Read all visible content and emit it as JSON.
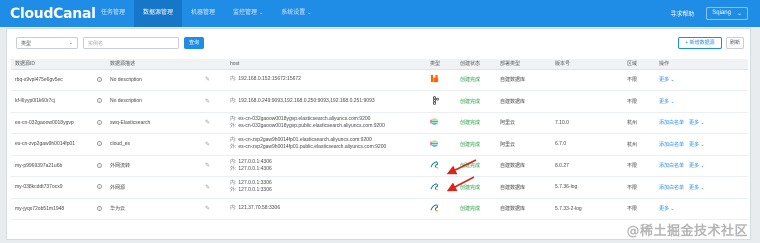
{
  "app": {
    "logo": "CloudCanal",
    "nav": [
      {
        "label": "任务管理",
        "active": false
      },
      {
        "label": "数据源管理",
        "active": true
      },
      {
        "label": "机器管理",
        "active": false
      },
      {
        "label": "监控管理",
        "active": false,
        "dropdown": true
      },
      {
        "label": "系统设置",
        "active": false,
        "dropdown": true
      }
    ],
    "help": "寻求帮助",
    "user": "Sqiang",
    "nav_arrow": "⌄"
  },
  "filters": {
    "type_placeholder": "类型",
    "search_placeholder": "实例名",
    "search_button": "查询",
    "add_button": "+ 新增数据源",
    "refresh_button": "刷新",
    "select_arrow": "⌄"
  },
  "table": {
    "headers": [
      "数据源ID",
      "数据源描述",
      "",
      "host",
      "类型",
      "创建状态",
      "部署类型",
      "版本号",
      "区域",
      "操作"
    ],
    "rows": [
      {
        "id": "rbq-s9vpl475e6gv5ec",
        "desc": "No description",
        "hosts": [
          {
            "p": "内:",
            "v": "192.168.0.152:15672:15672"
          }
        ],
        "type_icon": "rabbitmq",
        "status": "创建完成",
        "deploy": "自建数据库",
        "version": "",
        "region": "不限",
        "actions": [
          "更多 ⌄"
        ]
      },
      {
        "id": "kf-l6yyp0l1k60r7cj",
        "desc": "No description",
        "hosts": [
          {
            "p": "内:",
            "v": "192.168.0.249:9093,192.168.0.250:9093,192.168.0.251:9093"
          }
        ],
        "type_icon": "kafka",
        "status": "创建完成",
        "deploy": "自建数据库",
        "version": "",
        "region": "不限",
        "actions": [
          "更多 ⌄"
        ]
      },
      {
        "id": "es-cn-032gaoow0018ygvp",
        "desc": "swq-Elasticsearch",
        "hosts": [
          {
            "p": "内:",
            "v": "es-cn-032gaoow0018ygvp.elasticsearch.aliyuncs.com:9200"
          },
          {
            "p": "外:",
            "v": "es-cn-032gaoow0018ygvp.public.elasticsearch.aliyuncs.com:9200"
          }
        ],
        "type_icon": "elasticsearch",
        "status": "创建完成",
        "deploy": "阿里云",
        "version": "7.10.0",
        "region": "杭州",
        "actions": [
          "添加白名单",
          "更多 ⌄"
        ]
      },
      {
        "id": "es-cn-zvp2gaw9h0014fp01",
        "desc": "cloud_es",
        "hosts": [
          {
            "p": "内:",
            "v": "es-cn-zvp2gaw9h0014fp01.elasticsearch.aliyuncs.com:9200"
          },
          {
            "p": "外:",
            "v": "es-cn-zvp2gaw9h0014fp01.public.elasticsearch.aliyuncs.com:9200"
          }
        ],
        "type_icon": "elasticsearch",
        "status": "创建完成",
        "deploy": "阿里云",
        "version": "6.7.0",
        "region": "杭州",
        "actions": [
          "添加白名单",
          "更多 ⌄"
        ]
      },
      {
        "id": "my-p9969397a21u6b",
        "desc": "外网流转",
        "hosts": [
          {
            "p": "内:",
            "v": "127.0.0.1:4306"
          },
          {
            "p": "外:",
            "v": "127.0.0.1:4306"
          }
        ],
        "type_icon": "mysql",
        "status": "创建完成",
        "deploy": "自建数据库",
        "version": "8.0.27",
        "region": "不限",
        "actions": [
          "添加白名单",
          "更多 ⌄"
        ]
      },
      {
        "id": "my-038kcddt737ocx9",
        "desc": "外网源",
        "hosts": [
          {
            "p": "内:",
            "v": "127.0.0.1:3306"
          },
          {
            "p": "外:",
            "v": "127.0.0.1:3306"
          }
        ],
        "type_icon": "mysql",
        "status": "创建完成",
        "deploy": "自建数据库",
        "version": "5.7.36-log",
        "region": "不限",
        "actions": [
          "添加白名单",
          "更多 ⌄"
        ]
      },
      {
        "id": "my-jyqx72ob51m1948",
        "desc": "华为云",
        "hosts": [
          {
            "p": "内:",
            "v": "121.37.70.58:3306"
          }
        ],
        "type_icon": "mysql",
        "status": "创建完成",
        "deploy": "自建数据库",
        "version": "5.7.33-2-log",
        "region": "不限",
        "actions": [
          "更多 ⌄"
        ]
      }
    ]
  },
  "watermark": "@稀土掘金技术社区",
  "colors": {
    "brand": "#1f8ce6",
    "success": "#1f9b3f",
    "annotation": "#d9261c"
  }
}
